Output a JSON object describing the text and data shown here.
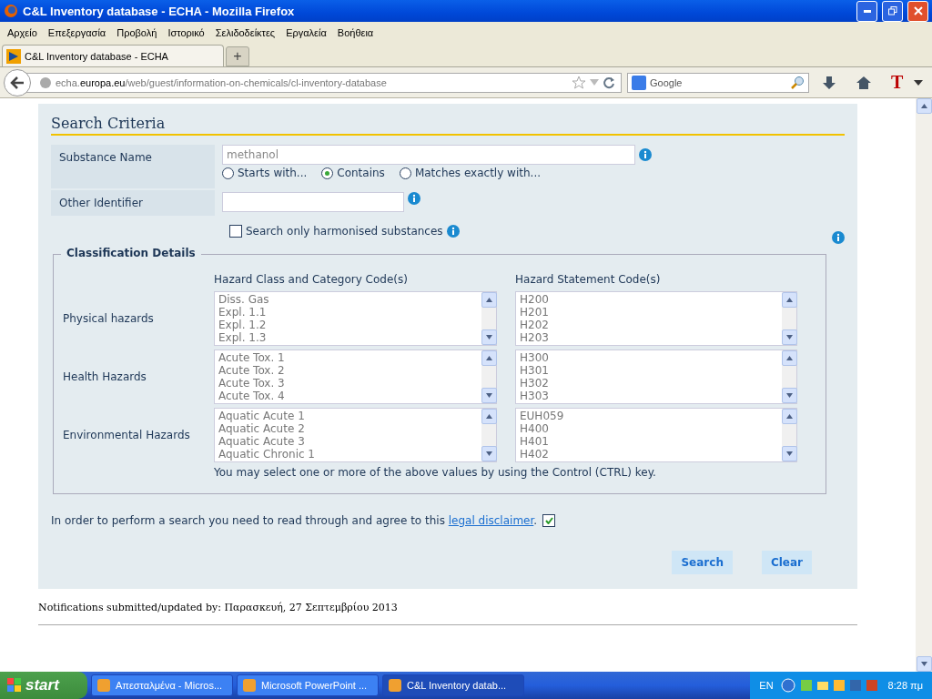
{
  "window": {
    "title": "C&L Inventory database - ECHA - Mozilla Firefox"
  },
  "menu": [
    "Αρχείο",
    "Επεξεργασία",
    "Προβολή",
    "Ιστορικό",
    "Σελιδοδείκτες",
    "Εργαλεία",
    "Βοήθεια"
  ],
  "tabs": [
    {
      "label": "C&L Inventory database - ECHA",
      "selected": true
    }
  ],
  "new_tab": "+",
  "address": {
    "host_pre": "echa.",
    "host": "europa.eu",
    "path": "/web/guest/information-on-chemicals/cl-inventory-database"
  },
  "search_box": {
    "placeholder": "Google"
  },
  "toolbar_letter": "T",
  "form": {
    "title": "Search Criteria",
    "substance_name": {
      "label": "Substance Name",
      "value": "methanol"
    },
    "match_options": [
      {
        "label": "Starts with...",
        "selected": false
      },
      {
        "label": "Contains",
        "selected": true
      },
      {
        "label": "Matches exactly with...",
        "selected": false
      }
    ],
    "other_identifier": {
      "label": "Other Identifier"
    },
    "harmonised": {
      "label": "Search only harmonised substances",
      "checked": false
    },
    "classification": {
      "legend": "Classification Details",
      "col_1": "Hazard Class and Category Code(s)",
      "col_2": "Hazard Statement Code(s)",
      "rows": [
        {
          "label": "Physical hazards",
          "classes": [
            "Diss. Gas",
            "Expl. 1.1",
            "Expl. 1.2",
            "Expl. 1.3"
          ],
          "statements": [
            "H200",
            "H201",
            "H202",
            "H203"
          ]
        },
        {
          "label": "Health Hazards",
          "classes": [
            "Acute Tox. 1",
            "Acute Tox. 2",
            "Acute Tox. 3",
            "Acute Tox. 4"
          ],
          "statements": [
            "H300",
            "H301",
            "H302",
            "H303"
          ]
        },
        {
          "label": "Environmental Hazards",
          "classes": [
            "Aquatic Acute 1",
            "Aquatic Acute 2",
            "Aquatic Acute 3",
            "Aquatic Chronic 1"
          ],
          "statements": [
            "EUH059",
            "H400",
            "H401",
            "H402"
          ]
        }
      ],
      "hint": "You may select one or more of the above values by using the Control (CTRL) key."
    },
    "disclaimer": {
      "text": "In order to perform a search you need to read through and agree to this",
      "link": "legal disclaimer",
      "after": ".",
      "checked": true
    },
    "buttons": [
      "Search",
      "Clear"
    ]
  },
  "footer": "Notifications submitted/updated by: Παρασκευή, 27 Σεπτεμβρίου 2013",
  "taskbar": {
    "start": "start",
    "items": [
      {
        "label": "Απεσταλμένα - Micros...",
        "selected": false
      },
      {
        "label": "Microsoft PowerPoint ...",
        "selected": false
      },
      {
        "label": "C&L Inventory datab...",
        "selected": true
      }
    ],
    "lang": "EN",
    "time": "8:28 πμ"
  }
}
